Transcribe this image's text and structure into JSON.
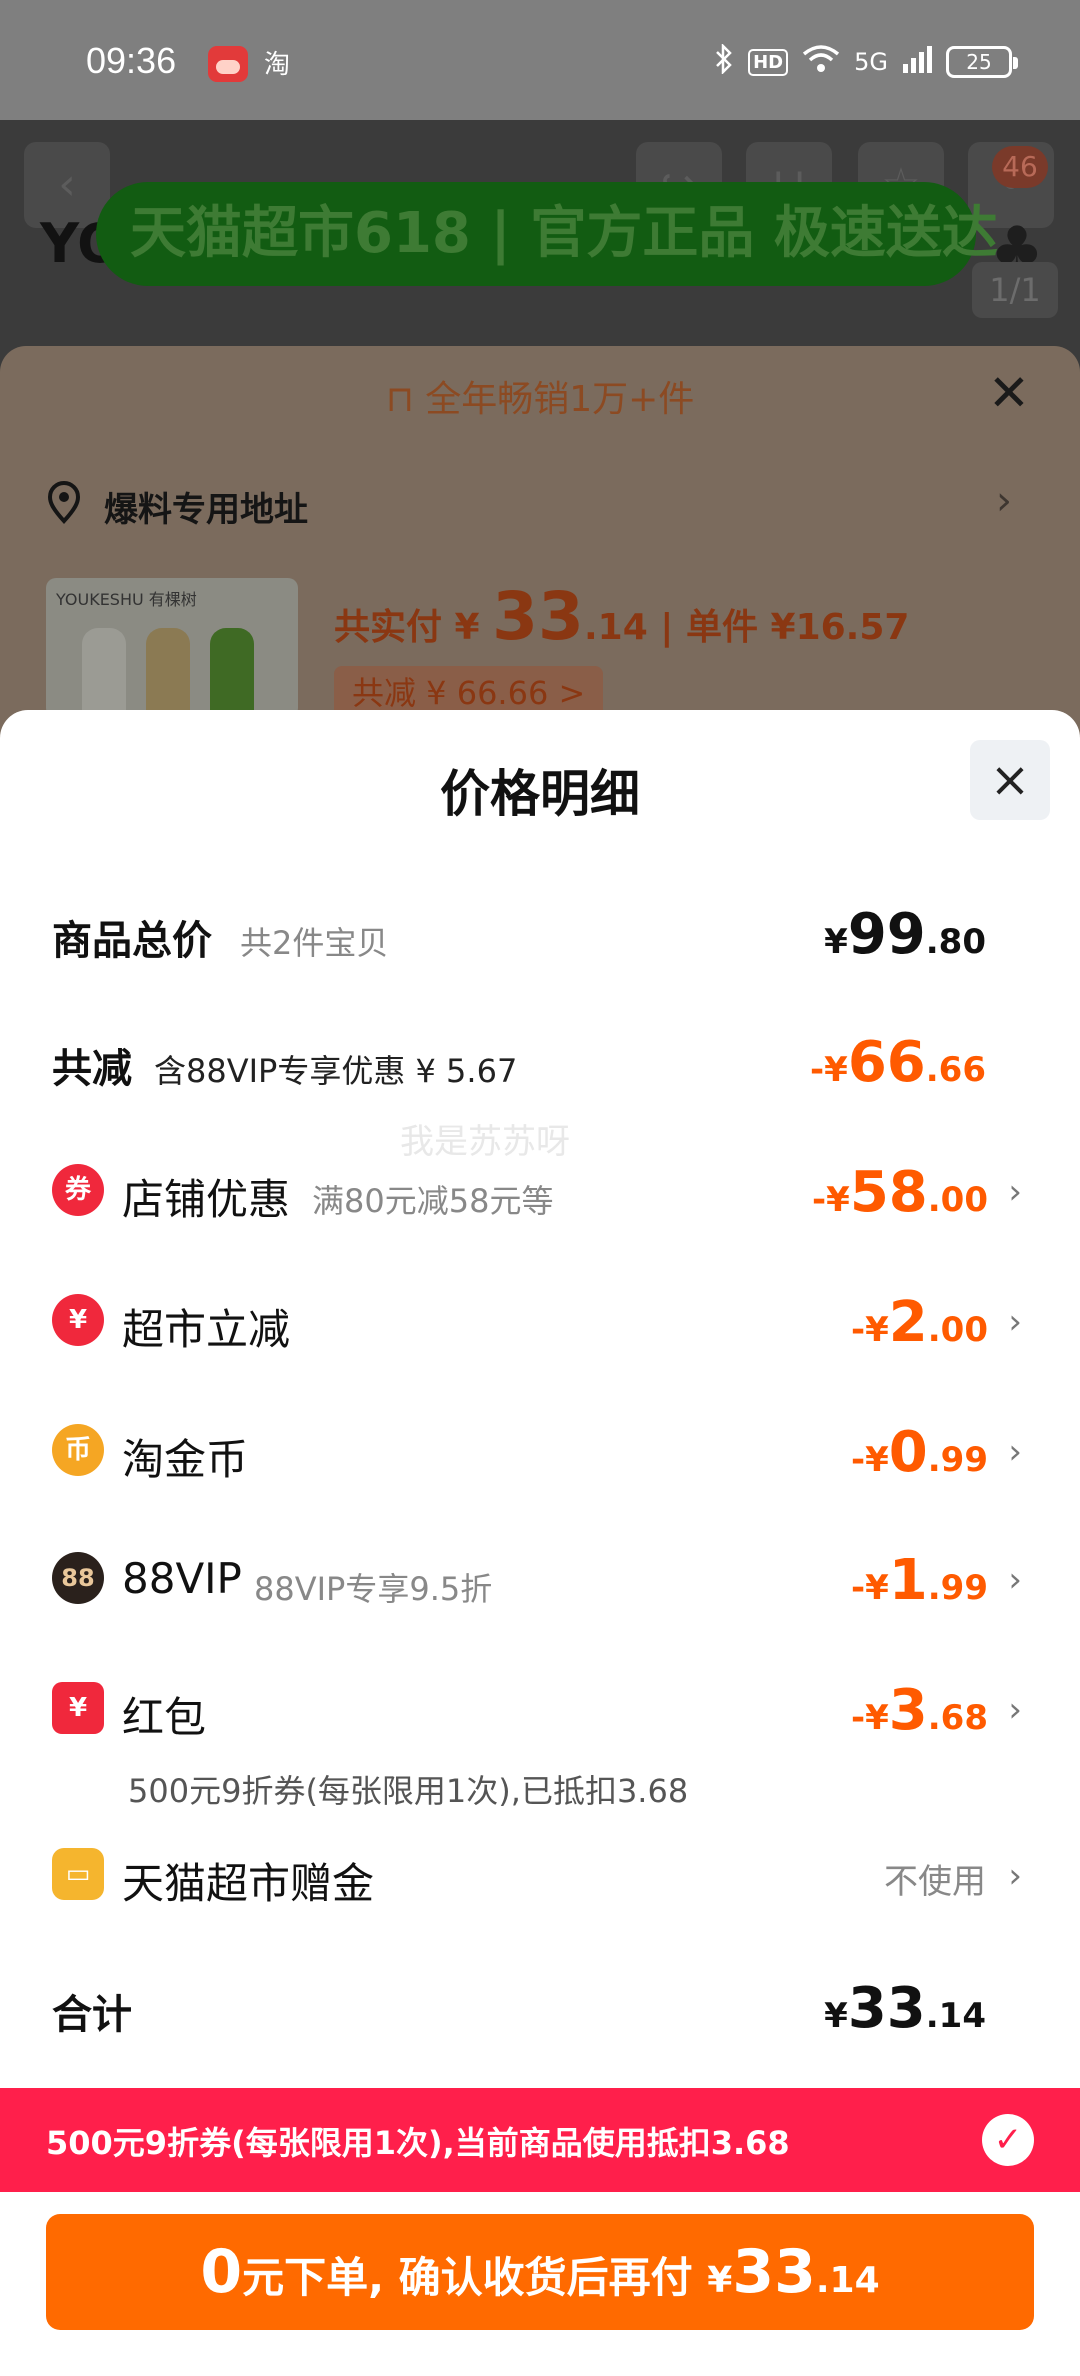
{
  "status_bar": {
    "time": "09:36",
    "app2_glyph": "淘",
    "hd_label": "HD",
    "network": "5G",
    "battery": "25"
  },
  "background_page": {
    "cart_badge": "46",
    "title_fragment": "YO",
    "banner": "天猫超市618 | 官方正品 极速送达",
    "pager": "1/1",
    "sales_note": "全年畅销1万+件",
    "address": "爆料专用地址",
    "product_brand": "YOUKESHU 有棵树",
    "pay_prefix": "共实付 ¥ ",
    "pay_int": "33",
    "pay_dec": ".14",
    "unit_price": " | 单件 ¥16.57",
    "total_saved": "共减 ¥ 66.66 >"
  },
  "sheet": {
    "title": "价格明细",
    "close_icon": "×",
    "watermark": "我是苏苏呀",
    "rows": {
      "total": {
        "label": "商品总价",
        "sub": "共2件宝贝",
        "cur": "¥",
        "int": "99",
        "dec": ".80"
      },
      "reduce": {
        "label": "共减",
        "sub": "含88VIP专享优惠 ¥ 5.67",
        "cur": "-¥",
        "int": "66",
        "dec": ".66"
      },
      "store": {
        "icon": "券",
        "label": "店铺优惠",
        "sub": "满80元减58元等",
        "cur": "-¥",
        "int": "58",
        "dec": ".00"
      },
      "supermarket": {
        "icon": "¥",
        "label": "超市立减",
        "sub": "",
        "cur": "-¥",
        "int": "2",
        "dec": ".00"
      },
      "coins": {
        "icon": "币",
        "label": "淘金币",
        "sub": "",
        "cur": "-¥",
        "int": "0",
        "dec": ".99"
      },
      "vip": {
        "icon": "88",
        "label": "88VIP",
        "sub": "88VIP专享9.5折",
        "cur": "-¥",
        "int": "1",
        "dec": ".99"
      },
      "redpacket": {
        "icon": "¥",
        "label": "红包",
        "note": "500元9折券(每张限用1次),已抵扣3.68",
        "cur": "-¥",
        "int": "3",
        "dec": ".68"
      },
      "gift": {
        "icon": "▭",
        "label": "天猫超市赠金",
        "status": "不使用"
      },
      "sum": {
        "label": "合计",
        "cur": "¥",
        "int": "33",
        "dec": ".14"
      }
    },
    "chevron": "›"
  },
  "coupon_bar": {
    "text": "500元9折券(每张限用1次),当前商品使用抵扣3.68",
    "check": "✓"
  },
  "cta": {
    "zero": "0",
    "text": "元下单, 确认收货后再付 ",
    "cur": "¥",
    "int": "33",
    "dec": ".14"
  },
  "colors": {
    "accent_orange": "#ff6a00",
    "discount_orange": "#ff5a00",
    "coupon_red": "#ff1f4b"
  }
}
